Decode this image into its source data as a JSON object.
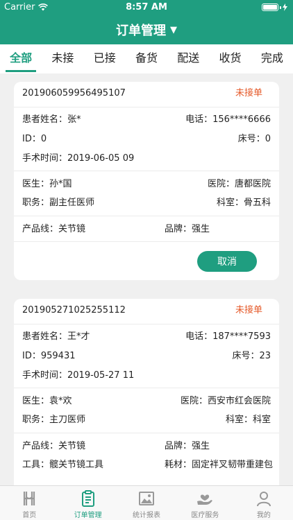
{
  "status_bar": {
    "carrier": "Carrier",
    "time": "8:57 AM"
  },
  "nav": {
    "title": "订单管理",
    "caret": "▼"
  },
  "tabs": [
    {
      "label": "全部",
      "active": true
    },
    {
      "label": "未接"
    },
    {
      "label": "已接"
    },
    {
      "label": "备货"
    },
    {
      "label": "配送"
    },
    {
      "label": "收货"
    },
    {
      "label": "完成"
    }
  ],
  "orders": [
    {
      "order_no": "201906059956495107",
      "status": "未接单",
      "patient_label": "患者姓名：",
      "patient": "张*",
      "phone_label": "电话：",
      "phone": "156****6666",
      "id_label": "ID：",
      "id": "0",
      "bed_label": "床号：",
      "bed": "0",
      "surgery_label": "手术时间：",
      "surgery_time": "2019-06-05 09",
      "doctor_label": "医生：",
      "doctor": "孙*国",
      "hospital_label": "医院：",
      "hospital": "唐都医院",
      "title_label": "职务：",
      "title": "副主任医师",
      "dept_label": "科室：",
      "dept": "骨五科",
      "product_label": "产品线：",
      "product": "关节镜",
      "brand_label": "品牌：",
      "brand": "强生",
      "cancel_label": "取消"
    },
    {
      "order_no": "201905271025255112",
      "status": "未接单",
      "patient_label": "患者姓名：",
      "patient": "王*才",
      "phone_label": "电话：",
      "phone": "187****7593",
      "id_label": "ID：",
      "id": "959431",
      "bed_label": "床号：",
      "bed": "23",
      "surgery_label": "手术时间：",
      "surgery_time": "2019-05-27 11",
      "doctor_label": "医生：",
      "doctor": "袁*欢",
      "hospital_label": "医院：",
      "hospital": "西安市红会医院",
      "title_label": "职务：",
      "title": "主刀医师",
      "dept_label": "科室：",
      "dept": "科室",
      "product_label": "产品线：",
      "product": "关节镜",
      "brand_label": "品牌：",
      "brand": "强生",
      "tool_label": "工具：",
      "tool": "髋关节镜工具",
      "material_label": "耗材：",
      "material": "固定袢叉韧带重建包"
    }
  ],
  "tabbar": [
    {
      "label": "首页",
      "icon": "home-icon"
    },
    {
      "label": "订单管理",
      "icon": "order-clipboard-icon",
      "active": true
    },
    {
      "label": "统计报表",
      "icon": "report-image-icon"
    },
    {
      "label": "医疗服务",
      "icon": "medical-service-icon"
    },
    {
      "label": "我的",
      "icon": "profile-icon"
    }
  ],
  "colors": {
    "brand": "#1f9e80",
    "status_pending": "#e55a2a"
  }
}
